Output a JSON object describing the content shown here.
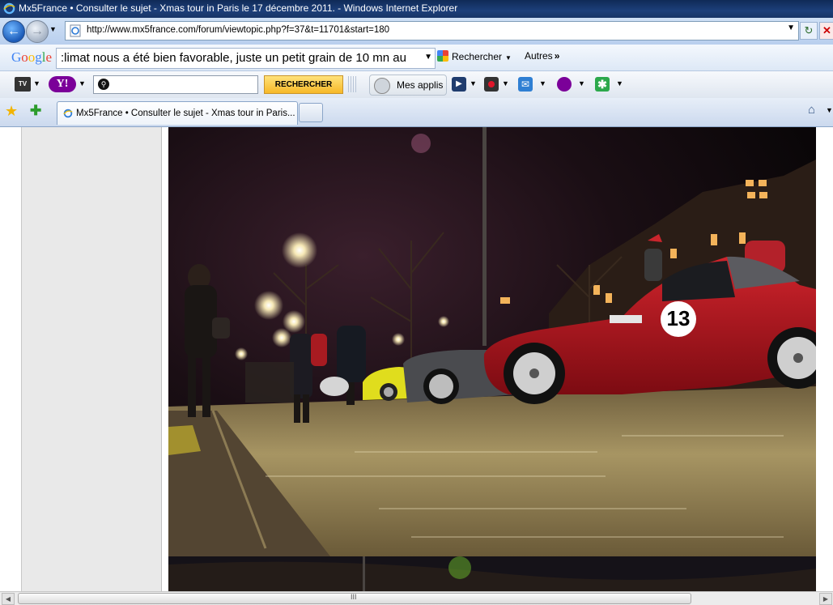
{
  "window": {
    "title": "Mx5France • Consulter le sujet - Xmas tour in Paris le 17 décembre 2011. - Windows Internet Explorer"
  },
  "address_bar": {
    "url": "http://www.mx5france.com/forum/viewtopic.php?f=37&t=11701&start=180"
  },
  "google_toolbar": {
    "logo": "Google",
    "search_value": ":limat nous a été bien favorable, juste un petit grain de 10 mn au",
    "search_button": "Rechercher",
    "more_label": "Autres"
  },
  "yahoo_toolbar": {
    "tv_label": "TV",
    "yahoo_label": "Y!",
    "search_value": "",
    "search_button": "RECHERCHER",
    "apps_label": "Mes applis"
  },
  "tab": {
    "label": "Mx5France • Consulter le sujet - Xmas tour in Paris..."
  },
  "photo": {
    "car_number": "13"
  },
  "scrollbar": {
    "grip": "III"
  },
  "colors": {
    "titlebar": "#1d3f7a",
    "accent_button": "#f7b827",
    "car_red": "#a3111a"
  }
}
